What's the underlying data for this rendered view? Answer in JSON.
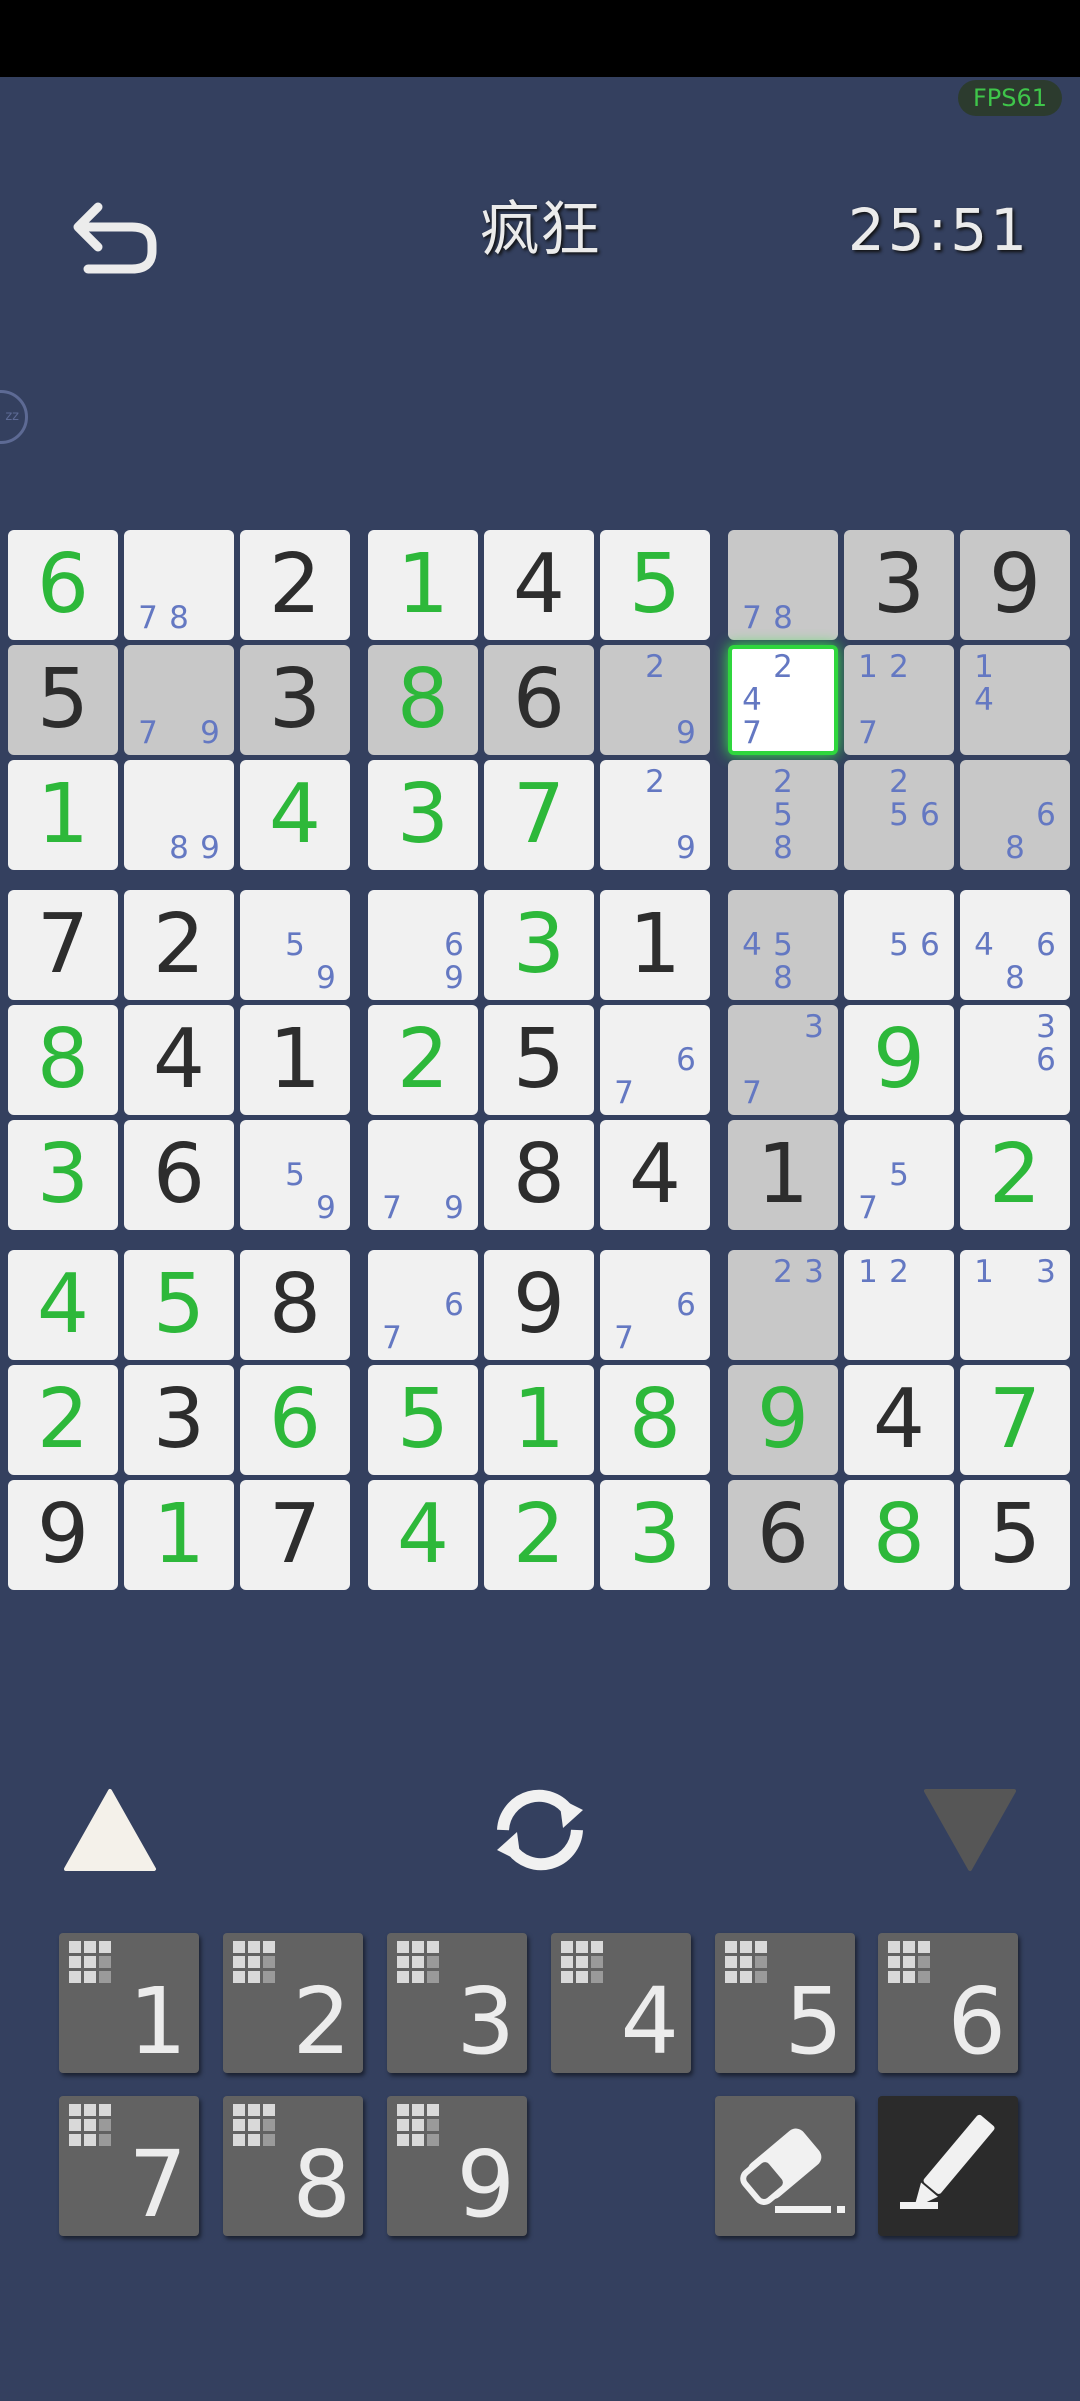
{
  "fps": "FPS61",
  "title": "疯狂",
  "timer": "25:51",
  "side_badge": "zz",
  "selected_cell": {
    "row": 2,
    "col": 7
  },
  "colors": {
    "given": "#2d2d2d",
    "user_entry": "#2db83a",
    "note": "#6478c2",
    "highlight": "#c8c8c8",
    "selection": "#2fd63d"
  },
  "board": [
    [
      {
        "v": "6",
        "t": "user"
      },
      {
        "n": "78"
      },
      {
        "v": "2",
        "t": "given"
      },
      {
        "v": "1",
        "t": "user"
      },
      {
        "v": "4",
        "t": "given"
      },
      {
        "v": "5",
        "t": "user"
      },
      {
        "n": "78",
        "hl": true
      },
      {
        "v": "3",
        "t": "given",
        "hl": true
      },
      {
        "v": "9",
        "t": "given",
        "hl": true
      }
    ],
    [
      {
        "v": "5",
        "t": "given",
        "hl": true
      },
      {
        "n": "79",
        "hl": true
      },
      {
        "v": "3",
        "t": "given",
        "hl": true
      },
      {
        "v": "8",
        "t": "user",
        "hl": true
      },
      {
        "v": "6",
        "t": "given",
        "hl": true
      },
      {
        "n": "29",
        "hl": true
      },
      {
        "n": "247",
        "sel": true
      },
      {
        "n": "127",
        "hl": true
      },
      {
        "n": "14",
        "hl": true
      }
    ],
    [
      {
        "v": "1",
        "t": "user"
      },
      {
        "n": "89"
      },
      {
        "v": "4",
        "t": "user"
      },
      {
        "v": "3",
        "t": "user"
      },
      {
        "v": "7",
        "t": "user"
      },
      {
        "n": "29"
      },
      {
        "n": "258",
        "hl": true
      },
      {
        "n": "256",
        "hl": true
      },
      {
        "n": "68",
        "hl": true
      }
    ],
    [
      {
        "v": "7",
        "t": "given"
      },
      {
        "v": "2",
        "t": "given"
      },
      {
        "n": "59"
      },
      {
        "n": "69"
      },
      {
        "v": "3",
        "t": "user"
      },
      {
        "v": "1",
        "t": "given"
      },
      {
        "n": "458",
        "hl": true
      },
      {
        "n": "56"
      },
      {
        "n": "468"
      }
    ],
    [
      {
        "v": "8",
        "t": "user"
      },
      {
        "v": "4",
        "t": "given"
      },
      {
        "v": "1",
        "t": "given"
      },
      {
        "v": "2",
        "t": "user"
      },
      {
        "v": "5",
        "t": "given"
      },
      {
        "n": "67"
      },
      {
        "n": "37",
        "hl": true
      },
      {
        "v": "9",
        "t": "user"
      },
      {
        "n": "36"
      }
    ],
    [
      {
        "v": "3",
        "t": "user"
      },
      {
        "v": "6",
        "t": "given"
      },
      {
        "n": "59"
      },
      {
        "n": "79"
      },
      {
        "v": "8",
        "t": "given"
      },
      {
        "v": "4",
        "t": "given"
      },
      {
        "v": "1",
        "t": "given",
        "hl": true
      },
      {
        "n": "57"
      },
      {
        "v": "2",
        "t": "user"
      }
    ],
    [
      {
        "v": "4",
        "t": "user"
      },
      {
        "v": "5",
        "t": "user"
      },
      {
        "v": "8",
        "t": "given"
      },
      {
        "n": "67"
      },
      {
        "v": "9",
        "t": "given"
      },
      {
        "n": "67"
      },
      {
        "n": "23",
        "hl": true
      },
      {
        "n": "12"
      },
      {
        "n": "13"
      }
    ],
    [
      {
        "v": "2",
        "t": "user"
      },
      {
        "v": "3",
        "t": "given"
      },
      {
        "v": "6",
        "t": "user"
      },
      {
        "v": "5",
        "t": "user"
      },
      {
        "v": "1",
        "t": "user"
      },
      {
        "v": "8",
        "t": "user"
      },
      {
        "v": "9",
        "t": "user",
        "hl": true
      },
      {
        "v": "4",
        "t": "given"
      },
      {
        "v": "7",
        "t": "user"
      }
    ],
    [
      {
        "v": "9",
        "t": "given"
      },
      {
        "v": "1",
        "t": "user"
      },
      {
        "v": "7",
        "t": "given"
      },
      {
        "v": "4",
        "t": "user"
      },
      {
        "v": "2",
        "t": "user"
      },
      {
        "v": "3",
        "t": "user"
      },
      {
        "v": "6",
        "t": "given",
        "hl": true
      },
      {
        "v": "8",
        "t": "user"
      },
      {
        "v": "5",
        "t": "given"
      }
    ]
  ],
  "controls": {
    "up": "up-triangle",
    "cycle": "refresh-icon",
    "down": "down-triangle"
  },
  "number_buttons": [
    {
      "label": "1",
      "remaining": 9
    },
    {
      "label": "2",
      "remaining": 9
    },
    {
      "label": "3",
      "remaining": 9
    },
    {
      "label": "4",
      "remaining": 9
    },
    {
      "label": "5",
      "remaining": 9
    },
    {
      "label": "6",
      "remaining": 9
    },
    {
      "label": "7",
      "remaining": 9
    },
    {
      "label": "8",
      "remaining": 9
    },
    {
      "label": "9",
      "remaining": 9
    }
  ],
  "tools": {
    "eraser": "eraser-icon",
    "pencil": "pencil-icon",
    "pencil_active": true
  }
}
